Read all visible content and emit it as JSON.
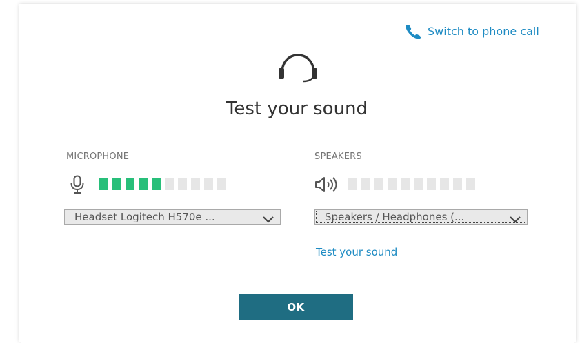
{
  "header": {
    "switch_to_phone_label": "Switch to phone call",
    "title": "Test your sound"
  },
  "microphone": {
    "label": "MICROPHONE",
    "device": "Headset Logitech H570e ...",
    "level_bars_total": 10,
    "level_bars_active": 5
  },
  "speakers": {
    "label": "SPEAKERS",
    "device": "Speakers / Headphones (...",
    "level_bars_total": 10,
    "level_bars_active": 0,
    "test_link_label": "Test your sound"
  },
  "footer": {
    "ok_label": "OK"
  },
  "icons": {
    "phone": "phone-icon",
    "headset": "headset-icon",
    "microphone": "microphone-icon",
    "speaker": "speaker-icon",
    "dropdown": "chevron-down-icon"
  },
  "colors": {
    "link": "#1e8bc3",
    "level_active": "#28bf7a",
    "level_inactive": "#e6e6e6",
    "primary_button": "#1f6d82"
  }
}
